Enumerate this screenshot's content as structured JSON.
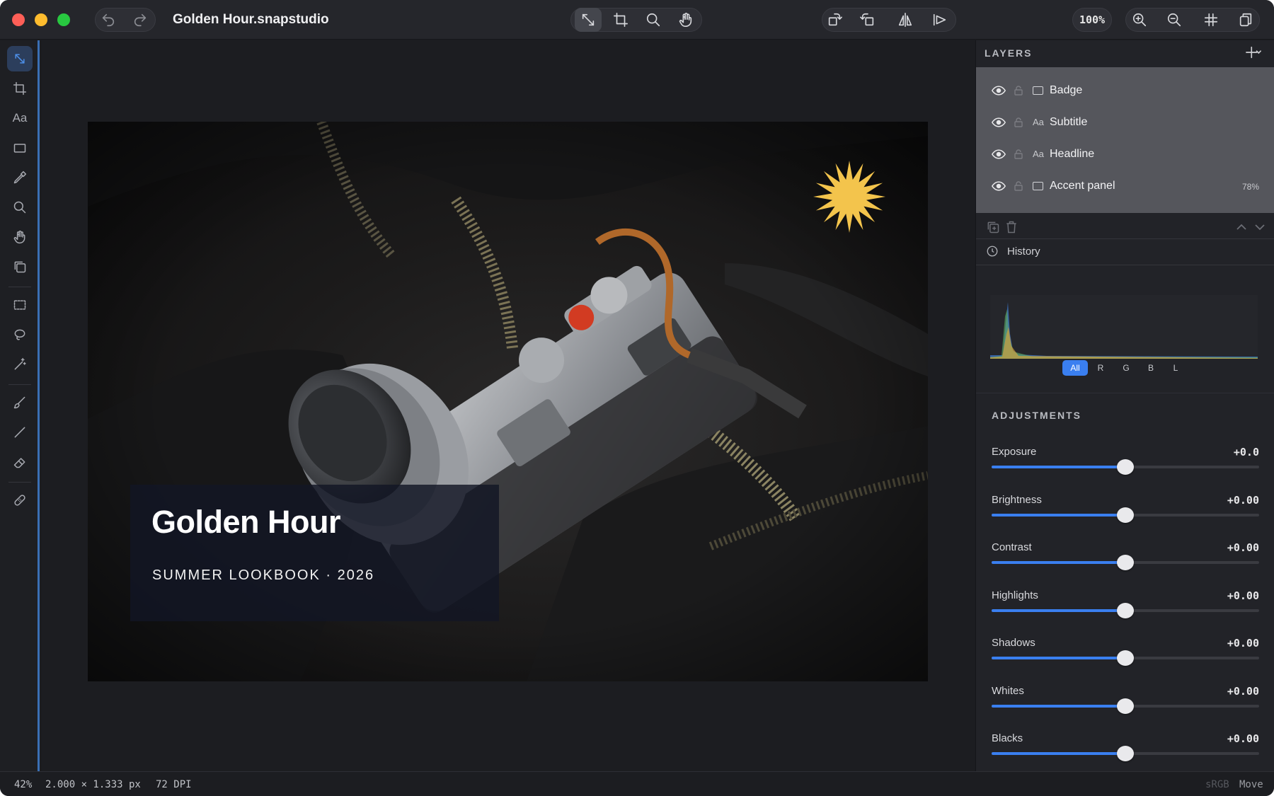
{
  "window": {
    "title": "Golden Hour.snapstudio"
  },
  "toolbar": {
    "zoom": "100%"
  },
  "canvas": {
    "headline": "Golden Hour",
    "subtitle": "SUMMER LOOKBOOK · 2026"
  },
  "layers": {
    "title": "LAYERS",
    "items": [
      {
        "name": "Badge",
        "kind": "shape",
        "opacity": ""
      },
      {
        "name": "Subtitle",
        "kind": "Aa",
        "opacity": ""
      },
      {
        "name": "Headline",
        "kind": "Aa",
        "opacity": ""
      },
      {
        "name": "Accent panel",
        "kind": "shape",
        "opacity": "78%"
      }
    ]
  },
  "history": {
    "label": "History"
  },
  "histogram": {
    "tabs": [
      "All",
      "R",
      "G",
      "B",
      "L"
    ],
    "active": "All"
  },
  "adjustments": {
    "title": "ADJUSTMENTS",
    "items": [
      {
        "label": "Exposure",
        "value": "+0.0",
        "level": 0.5
      },
      {
        "label": "Brightness",
        "value": "+0.00",
        "level": 0.5
      },
      {
        "label": "Contrast",
        "value": "+0.00",
        "level": 0.5
      },
      {
        "label": "Highlights",
        "value": "+0.00",
        "level": 0.5
      },
      {
        "label": "Shadows",
        "value": "+0.00",
        "level": 0.5
      },
      {
        "label": "Whites",
        "value": "+0.00",
        "level": 0.5
      },
      {
        "label": "Blacks",
        "value": "+0.00",
        "level": 0.5
      }
    ]
  },
  "status": {
    "zoom": "42%",
    "dimensions": "2.000 × 1.333 px",
    "dpi": "72 DPI",
    "colorspace": "sRGB",
    "tool": "Move"
  },
  "colors": {
    "accent": "#3a7ff0",
    "badge": "#f3c44c"
  }
}
